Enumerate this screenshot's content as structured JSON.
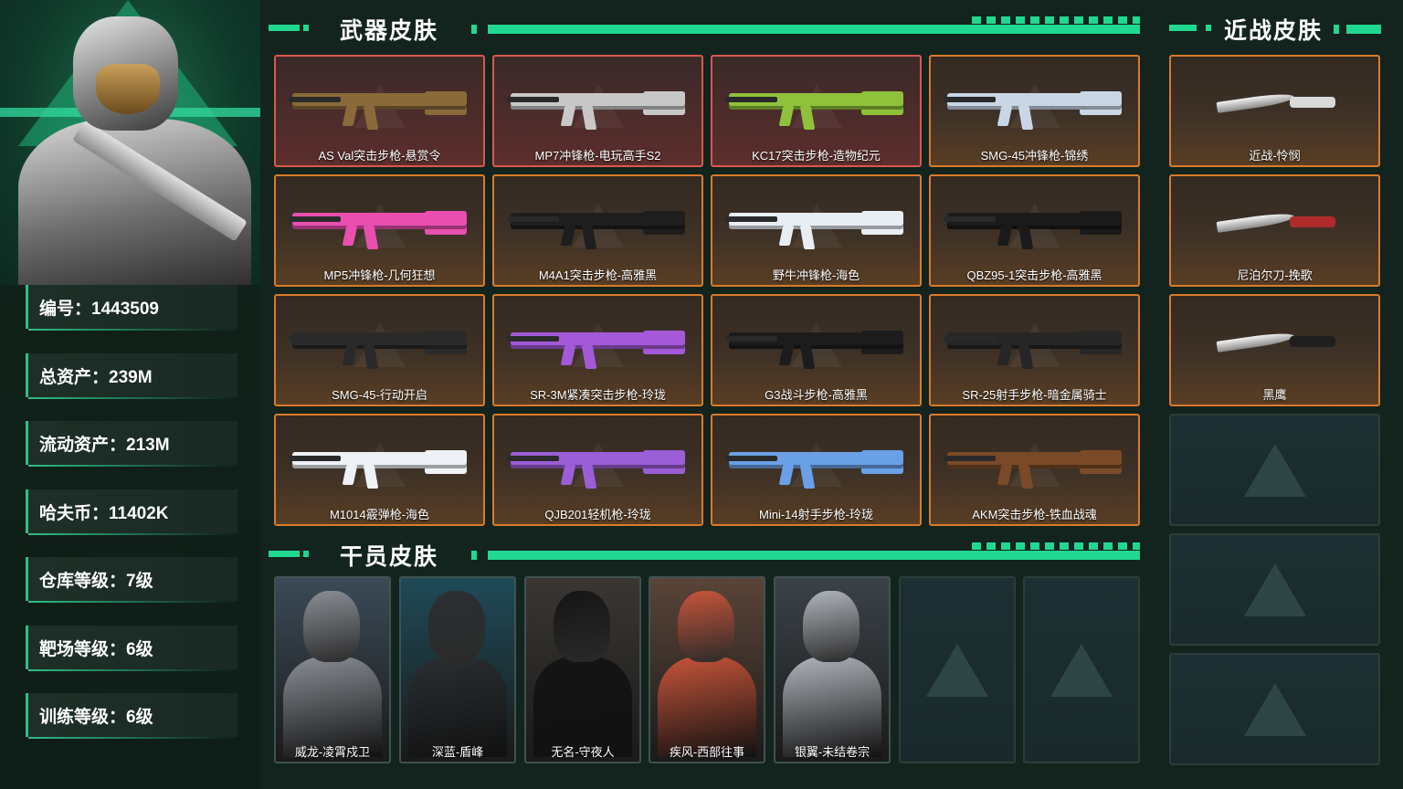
{
  "profile": {
    "stats": [
      {
        "label": "编号：1443509"
      },
      {
        "label": "总资产：239M"
      },
      {
        "label": "流动资产：213M"
      },
      {
        "label": "哈夫币：11402K"
      },
      {
        "label": "仓库等级：7级"
      },
      {
        "label": "靶场等级：6级"
      },
      {
        "label": "训练等级：6级"
      }
    ]
  },
  "weapon_section": {
    "title": "武器皮肤",
    "items": [
      {
        "name": "AS Val突击步枪-悬赏令",
        "rarity": "red",
        "color": "#8a6a3a"
      },
      {
        "name": "MP7冲锋枪-电玩高手S2",
        "rarity": "red",
        "color": "#c8c8c8"
      },
      {
        "name": "KC17突击步枪-造物纪元",
        "rarity": "red",
        "color": "#8fc23a"
      },
      {
        "name": "SMG-45冲锋枪-锦绣",
        "rarity": "orange",
        "color": "#c9d6e6"
      },
      {
        "name": "MP5冲锋枪-几何狂想",
        "rarity": "orange",
        "color": "#e84fae"
      },
      {
        "name": "M4A1突击步枪-高雅黑",
        "rarity": "orange",
        "color": "#1e1e1e"
      },
      {
        "name": "野牛冲锋枪-海色",
        "rarity": "orange",
        "color": "#e9eef5"
      },
      {
        "name": "QBZ95-1突击步枪-高雅黑",
        "rarity": "orange",
        "color": "#1a1a1a"
      },
      {
        "name": "SMG-45-行动开启",
        "rarity": "orange",
        "color": "#2a2a2a"
      },
      {
        "name": "SR-3M紧凑突击步枪-玲珑",
        "rarity": "orange",
        "color": "#a45ad8"
      },
      {
        "name": "G3战斗步枪-高雅黑",
        "rarity": "orange",
        "color": "#1c1c1c"
      },
      {
        "name": "SR-25射手步枪-暗金属骑士",
        "rarity": "orange",
        "color": "#262626"
      },
      {
        "name": "M1014霰弹枪-海色",
        "rarity": "orange",
        "color": "#eef1f6"
      },
      {
        "name": "QJB201轻机枪-玲珑",
        "rarity": "orange",
        "color": "#9a5ed6"
      },
      {
        "name": "Mini-14射手步枪-玲珑",
        "rarity": "orange",
        "color": "#6aa0e6"
      },
      {
        "name": "AKM突击步枪-铁血战魂",
        "rarity": "orange",
        "color": "#7a4a28"
      }
    ]
  },
  "melee_section": {
    "title": "近战皮肤",
    "items": [
      {
        "name": "近战-怜悯",
        "color": "#d9d9d9"
      },
      {
        "name": "尼泊尔刀-挽歌",
        "color": "#b12a2a"
      },
      {
        "name": "黑鹰",
        "color": "#1f1f1f"
      }
    ],
    "empty_slots": 3
  },
  "operator_section": {
    "title": "干员皮肤",
    "items": [
      {
        "name": "威龙-凌霄戍卫",
        "color": "#8a8f96",
        "bg": "#3b4a57"
      },
      {
        "name": "深蓝-盾峰",
        "color": "#2b2f33",
        "bg": "#1f4a58"
      },
      {
        "name": "无名-守夜人",
        "color": "#151515",
        "bg": "#3a3632"
      },
      {
        "name": "疾风-西部往事",
        "color": "#c8553a",
        "bg": "#5a4438"
      },
      {
        "name": "银翼-未结卷宗",
        "color": "#b0b6bd",
        "bg": "#3b4248"
      }
    ],
    "empty_slots": 2
  }
}
